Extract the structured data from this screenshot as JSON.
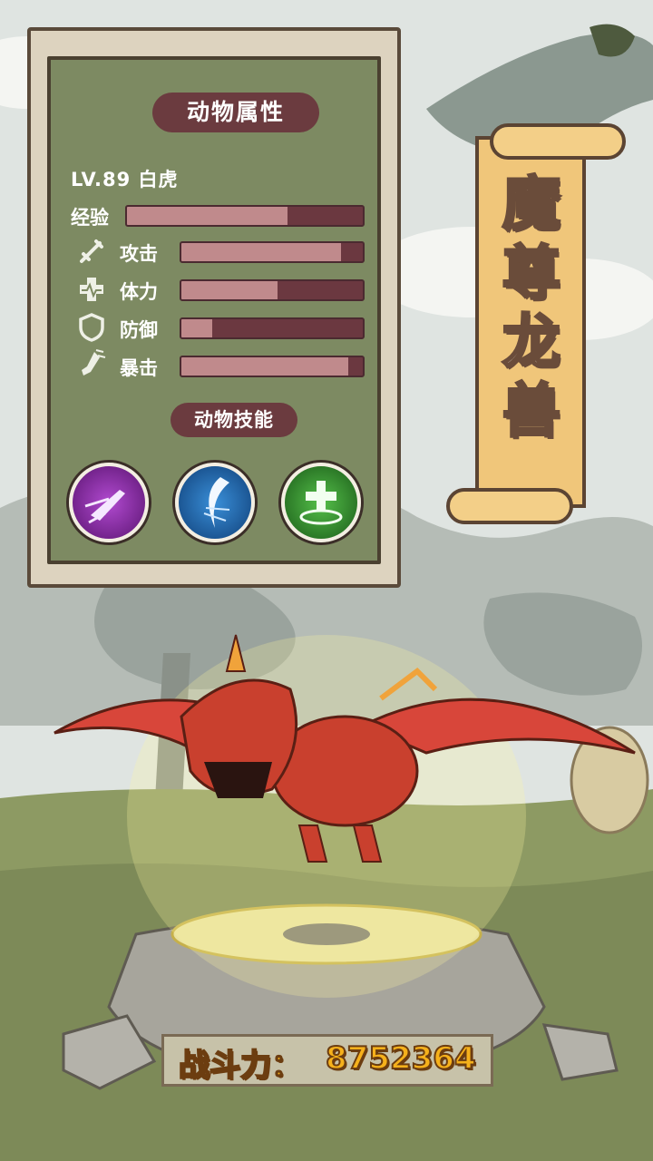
{
  "panel": {
    "title": "动物属性",
    "level_text": "LV.89 白虎",
    "exp_label": "经验",
    "exp_progress": 0.68,
    "stats": [
      {
        "label": "攻击",
        "icon": "sword-icon",
        "value": 0.88
      },
      {
        "label": "体力",
        "icon": "heart-cross-icon",
        "value": 0.53
      },
      {
        "label": "防御",
        "icon": "shield-icon",
        "value": 0.17
      },
      {
        "label": "暴击",
        "icon": "boot-icon",
        "value": 0.92
      }
    ],
    "skills_title": "动物技能",
    "skills": [
      {
        "icon": "rocket-skill-icon",
        "color": "#7a1f8e"
      },
      {
        "icon": "slash-skill-icon",
        "color": "#1f6aa8"
      },
      {
        "icon": "heal-skill-icon",
        "color": "#2e8a2a"
      }
    ]
  },
  "scroll_title": "魔尊龙兽",
  "combat_power": {
    "label": "战斗力：",
    "value": "8752364"
  }
}
